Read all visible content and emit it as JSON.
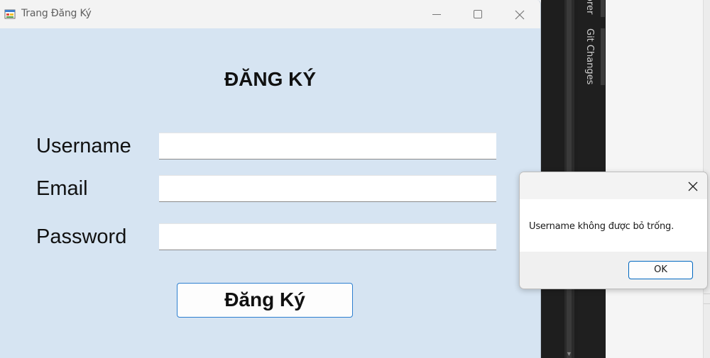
{
  "window": {
    "title": "Trang Đăng Ký",
    "controls": {
      "minimize": "minimize-icon",
      "maximize": "maximize-icon",
      "close": "close-icon"
    }
  },
  "form": {
    "heading": "ĐĂNG KÝ",
    "fields": {
      "username": {
        "label": "Username",
        "value": ""
      },
      "email": {
        "label": "Email",
        "value": ""
      },
      "password": {
        "label": "Password",
        "value": ""
      }
    },
    "submit_label": "Đăng Ký"
  },
  "message_box": {
    "message": "Username không được bỏ trống.",
    "ok_label": "OK"
  },
  "ide": {
    "panel_tabs": [
      "orer",
      "Git Changes"
    ]
  },
  "colors": {
    "form_background": "#d6e4f2",
    "button_border": "#2d7fd0",
    "ide_dark": "#1e1e1e"
  }
}
